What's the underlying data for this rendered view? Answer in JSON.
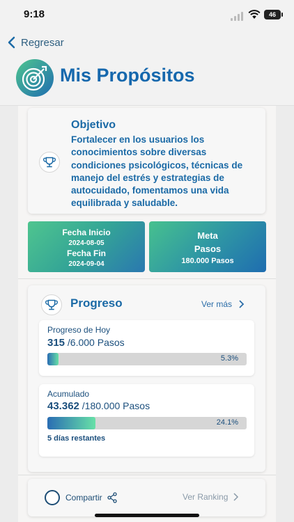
{
  "status_bar": {
    "time": "9:18",
    "battery": "46"
  },
  "nav": {
    "back_label": "Regresar"
  },
  "header": {
    "title": "Mis Propósitos"
  },
  "objetivo": {
    "title": "Objetivo",
    "text": "Fortalecer en los usuarios los conocimientos sobre diversas condiciones psicológicos, técnicas de manejo del estrés y estrategias de autocuidado, fomentamos una vida equilibrada y saludable."
  },
  "fechas": {
    "inicio_label": "Fecha Inicio",
    "inicio_value": "2024-08-05",
    "fin_label": "Fecha Fin",
    "fin_value": "2024-09-04"
  },
  "meta": {
    "label": "Meta",
    "unit": "Pasos",
    "value": "180.000 Pasos"
  },
  "progreso": {
    "title": "Progreso",
    "ver_mas": "Ver más",
    "hoy": {
      "label": "Progreso de Hoy",
      "current": "315",
      "target": "/6.000 Pasos",
      "percent_text": "5.3%",
      "fraction": 0.053
    },
    "acumulado": {
      "label": "Acumulado",
      "current": "43.362",
      "target": "/180.000 Pasos",
      "percent_text": "24.1%",
      "fraction": 0.241,
      "remaining": "5 días restantes"
    }
  },
  "footer": {
    "share_label": "Compartir",
    "ranking_label": "Ver Ranking"
  },
  "colors": {
    "accent": "#1668ad",
    "gradient_start": "#4fc58f",
    "gradient_end": "#2a78b0"
  }
}
